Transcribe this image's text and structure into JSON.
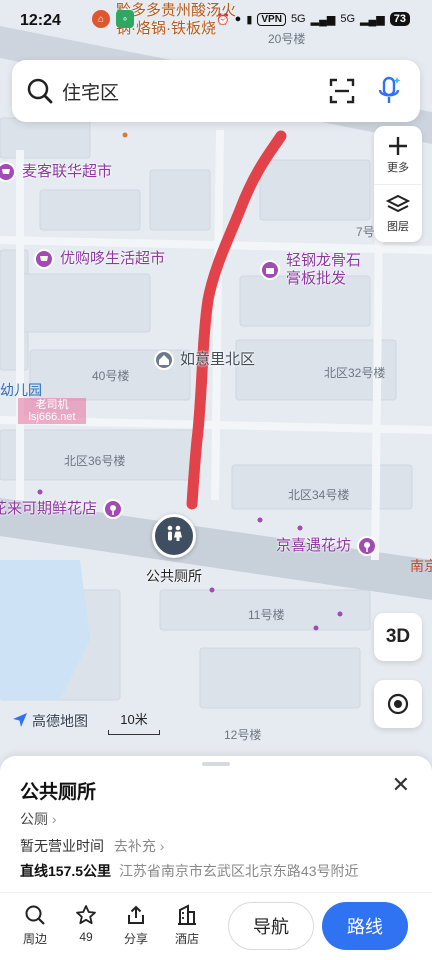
{
  "status_bar": {
    "time": "12:24",
    "vpn": "VPN",
    "signal1": "5G",
    "signal2": "5G",
    "battery": "73"
  },
  "header_shop": {
    "line1": "黔多多贵州酸汤火",
    "line2": "锅·烙锅·铁板烧"
  },
  "search": {
    "text": "住宅区"
  },
  "tools": {
    "more": "更多",
    "layers": "图层",
    "three_d": "3D"
  },
  "map": {
    "labels": {
      "building_20": "20号楼",
      "building_7": "7号",
      "building_40": "40号楼",
      "north_32": "北区32号楼",
      "north_36": "北区36号楼",
      "north_34": "北区34号楼",
      "building_11": "11号楼",
      "building_12": "12号楼",
      "kindergarten": "幼儿园",
      "nan": "南京"
    },
    "pois": {
      "maike": "麦客联华超市",
      "yougou": "优购哆生活超市",
      "light_steel_1": "轻钢龙骨石",
      "light_steel_2": "膏板批发",
      "rujing": "如意里北区",
      "flower_left": "花来可期鲜花店",
      "jingxi": "京喜遇花坊"
    },
    "toilet_label": "公共厕所",
    "watermark_1": "老司机",
    "watermark_2": "lsj666.net",
    "brand": "高德地图",
    "scale": "10米",
    "route_color": "#e2434b"
  },
  "sheet": {
    "title": "公共厕所",
    "category": "公厕",
    "hours": "暂无营业时间",
    "hours_supplement": "去补充",
    "distance": "直线157.5公里",
    "address": "江苏省南京市玄武区北京东路43号附近"
  },
  "actions": {
    "nearby": "周边",
    "favorites": "49",
    "share": "分享",
    "hotel": "酒店",
    "navigate": "导航",
    "route": "路线"
  }
}
